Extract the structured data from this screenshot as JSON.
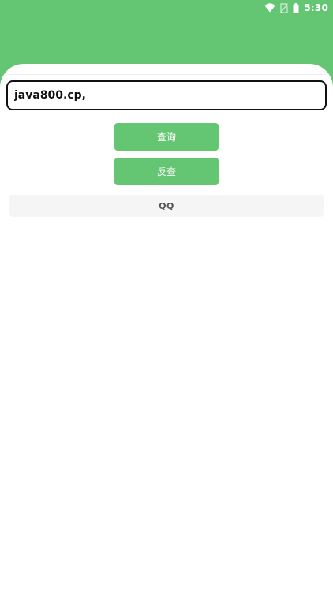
{
  "status_bar": {
    "time": "5:30",
    "icons": [
      "wifi-icon",
      "no-sim-icon",
      "battery-icon"
    ]
  },
  "colors": {
    "accent": "#64c673",
    "input_border": "#111111",
    "result_bg": "#f5f5f5"
  },
  "search": {
    "value": "java800.cp,",
    "placeholder": ""
  },
  "buttons": {
    "query_label": "查询",
    "reverse_label": "反查"
  },
  "result": {
    "text": "QQ"
  }
}
